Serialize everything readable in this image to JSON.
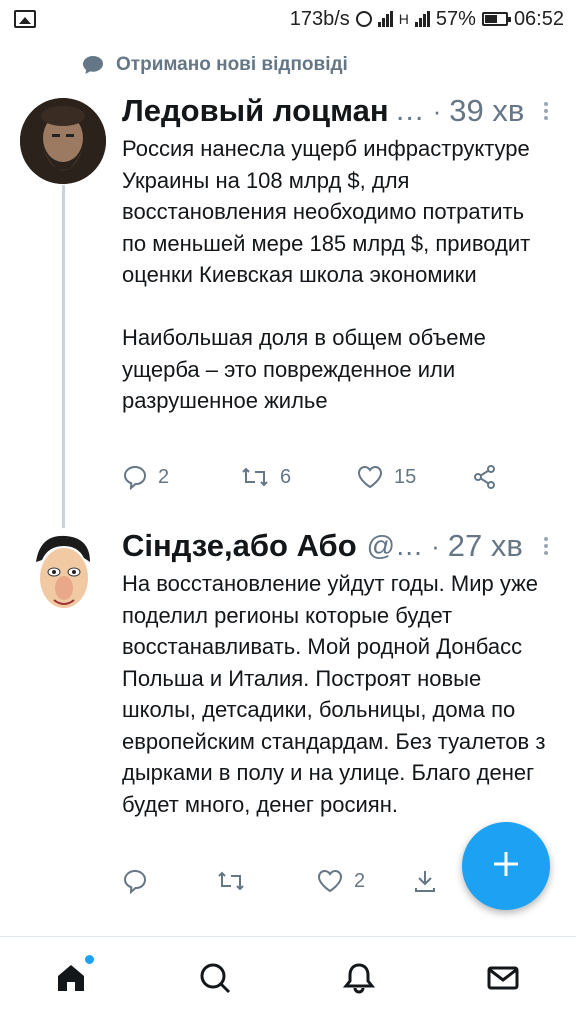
{
  "status_bar": {
    "net_speed": "173b/s",
    "sim2_label": "H",
    "battery_percent": "57%",
    "time": "06:52",
    "icons": [
      "image-icon",
      "alarm-clock-icon",
      "signal-icon",
      "signal-icon",
      "battery-icon"
    ]
  },
  "banner": {
    "text": "Отримано нові відповіді",
    "icon": "speech-bubble-icon"
  },
  "tweets": [
    {
      "author": "Ледовый лоцман",
      "handle_ellipsis": "…",
      "separator": "·",
      "time": "39 хв",
      "text": "Россия нанесла ущерб инфраструктуре Украины на 108 млрд $, для восстановления необходимо потратить по меньшей мере 185 млрд $, приводит оценки Киевская школа экономики\n\nНаибольшая доля в общем объеме ущерба – это поврежденное или разрушенное жилье",
      "replies": "2",
      "retweets": "6",
      "likes": "15"
    },
    {
      "author": "Сіндзе,або Або",
      "handle": "@…",
      "separator": "·",
      "time": "27 хв",
      "text": "На восстановление уйдут годы. Мир уже поделил регионы которые будет восстанавливать. Мой родной Донбасс Польша и Италия. Построят новые школы, детсадики, больницы, дома по европейским стандардам. Без туалетов з дырками в полу и на улице. Благо денег будет много, денег росиян.",
      "replies": "",
      "retweets": "",
      "likes": "2"
    }
  ],
  "fab": {
    "icon": "plus-icon"
  },
  "bottom_nav": [
    "home-icon",
    "search-icon",
    "notifications-icon",
    "messages-icon"
  ],
  "colors": {
    "accent": "#1da1f2",
    "muted": "#657786",
    "text": "#14171a"
  }
}
